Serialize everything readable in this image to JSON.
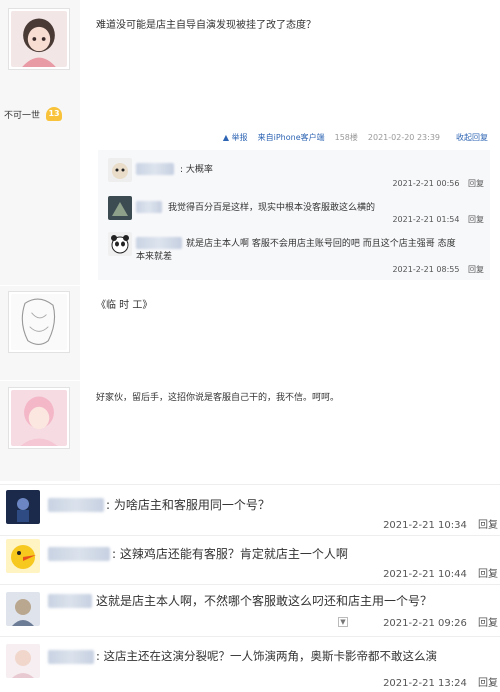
{
  "post1": {
    "text": "难道没可能是店主自导自演发现被挂了改了态度？",
    "username": "不可一世",
    "level": "13"
  },
  "meta": {
    "report": "举报",
    "source": "来自iPhone客户端",
    "floor": "158楼",
    "datetime": "2021-02-20 23:39",
    "collapse": "收起回复"
  },
  "replies": [
    {
      "text": ": 大概率",
      "date": "2021-2-21 00:56",
      "action": "回复"
    },
    {
      "text": "我觉得百分百是这样，现实中根本没客服敢这么横的",
      "date": "2021-2-21 01:54",
      "action": "回复"
    },
    {
      "text": "就是店主本人啊 客服不会用店主账号回的吧 而且这个店主强哥 态度",
      "text2": "本来就差",
      "date": "2021-2-21 08:55",
      "action": "回复"
    }
  ],
  "post2": {
    "text": "《临 时 工》"
  },
  "post3": {
    "text": "好家伙，留后手，这招你说是客服自己干的，我不信。呵呵。"
  },
  "comments": [
    {
      "text": ": 为啥店主和客服用同一个号？",
      "date": "2021-2-21 10:34",
      "action": "回复"
    },
    {
      "text": ": 这辣鸡店还能有客服？肯定就店主一个人啊",
      "date": "2021-2-21 10:44",
      "action": "回复"
    },
    {
      "text": "这就是店主本人啊，不然哪个客服敢这么叼还和店主用一个号？",
      "date": "2021-2-21 09:26",
      "action": "回复"
    },
    {
      "text": ": 这店主还在这演分裂呢？一人饰演两角，奥斯卡影帝都不敢这么演",
      "date": "2021-2-21 13:24",
      "action": "回复"
    }
  ],
  "colors": {
    "link": "#2d64b3",
    "sidebar": "#f7f7f7",
    "badge": "#f8c33a"
  }
}
